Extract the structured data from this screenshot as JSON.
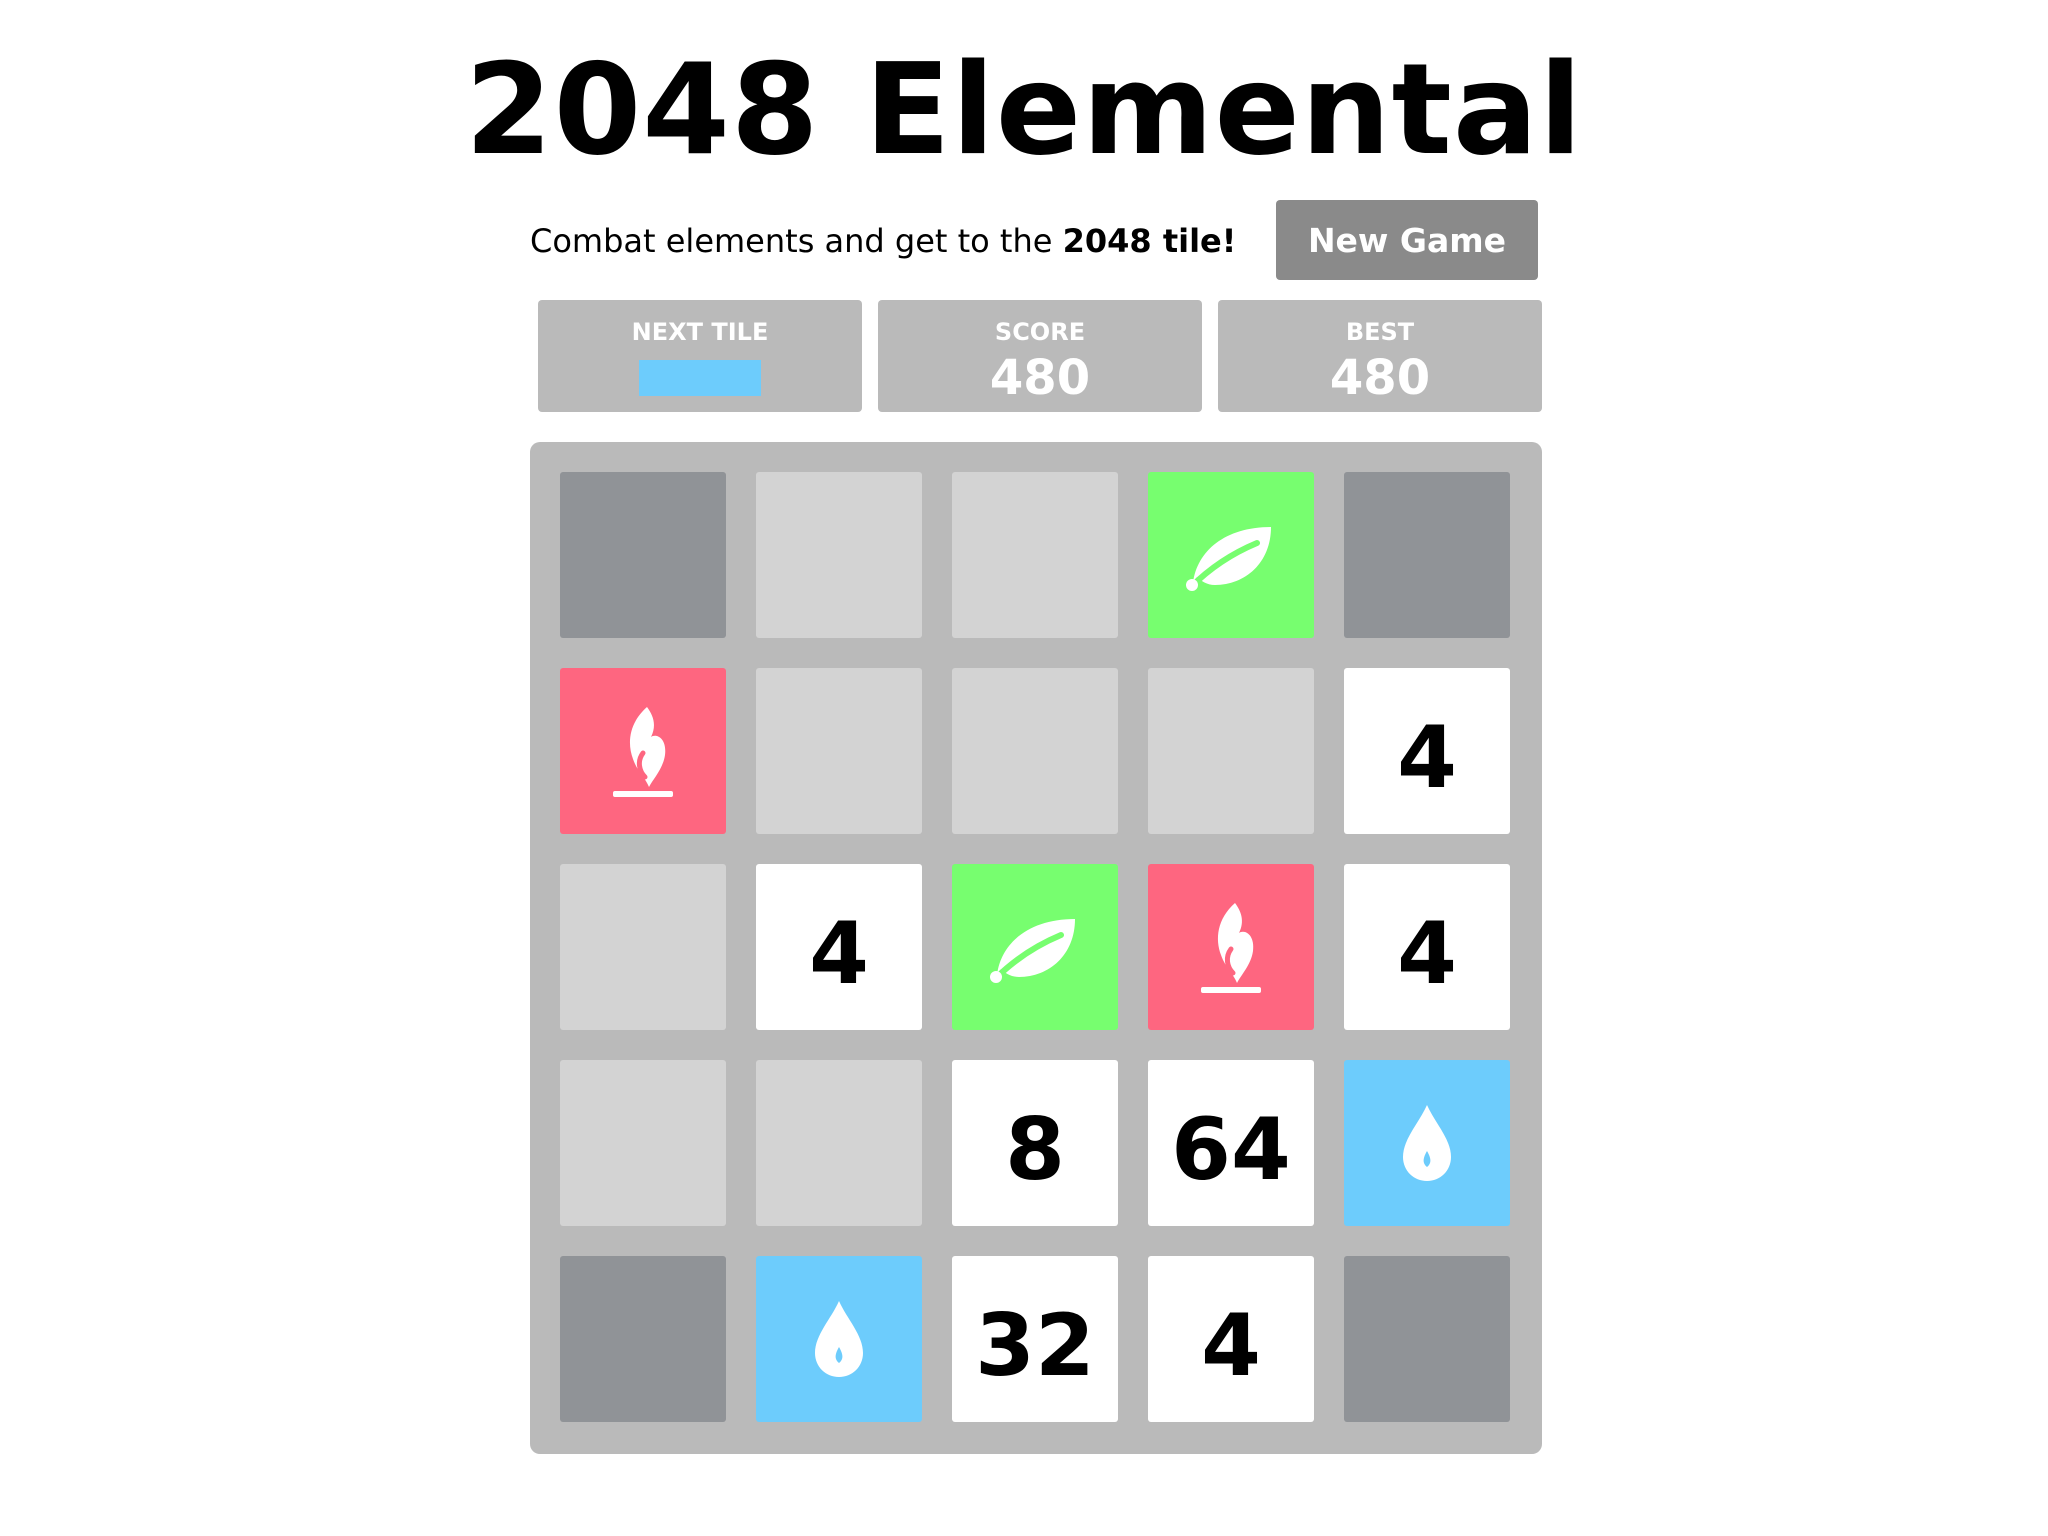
{
  "title": "2048 Elemental",
  "tagline": {
    "prefix": "Combat elements and get to the ",
    "bold": "2048 tile!"
  },
  "new_game_label": "New Game",
  "stats": {
    "next_tile_label": "NEXT TILE",
    "next_tile_type": "water",
    "score_label": "SCORE",
    "score_value": "480",
    "best_label": "BEST",
    "best_value": "480"
  },
  "colors": {
    "empty": "#d3d3d3",
    "blocked": "#909397",
    "number": "#ffffff",
    "fire": "#fe6680",
    "earth": "#77fe6f",
    "water": "#6dccfc",
    "board": "#bababa",
    "button": "#8a8a8a"
  },
  "grid": [
    [
      {
        "type": "blocked"
      },
      {
        "type": "empty"
      },
      {
        "type": "empty"
      },
      {
        "type": "earth",
        "icon": "leaf-icon"
      },
      {
        "type": "blocked"
      }
    ],
    [
      {
        "type": "fire",
        "icon": "flame-icon"
      },
      {
        "type": "empty"
      },
      {
        "type": "empty"
      },
      {
        "type": "empty"
      },
      {
        "type": "number",
        "value": "4"
      }
    ],
    [
      {
        "type": "empty"
      },
      {
        "type": "number",
        "value": "4"
      },
      {
        "type": "earth",
        "icon": "leaf-icon"
      },
      {
        "type": "fire",
        "icon": "flame-icon"
      },
      {
        "type": "number",
        "value": "4"
      }
    ],
    [
      {
        "type": "empty"
      },
      {
        "type": "empty"
      },
      {
        "type": "number",
        "value": "8"
      },
      {
        "type": "number",
        "value": "64"
      },
      {
        "type": "water",
        "icon": "water-drop-icon"
      }
    ],
    [
      {
        "type": "blocked"
      },
      {
        "type": "water",
        "icon": "water-drop-icon"
      },
      {
        "type": "number",
        "value": "32"
      },
      {
        "type": "number",
        "value": "4"
      },
      {
        "type": "blocked"
      }
    ]
  ]
}
